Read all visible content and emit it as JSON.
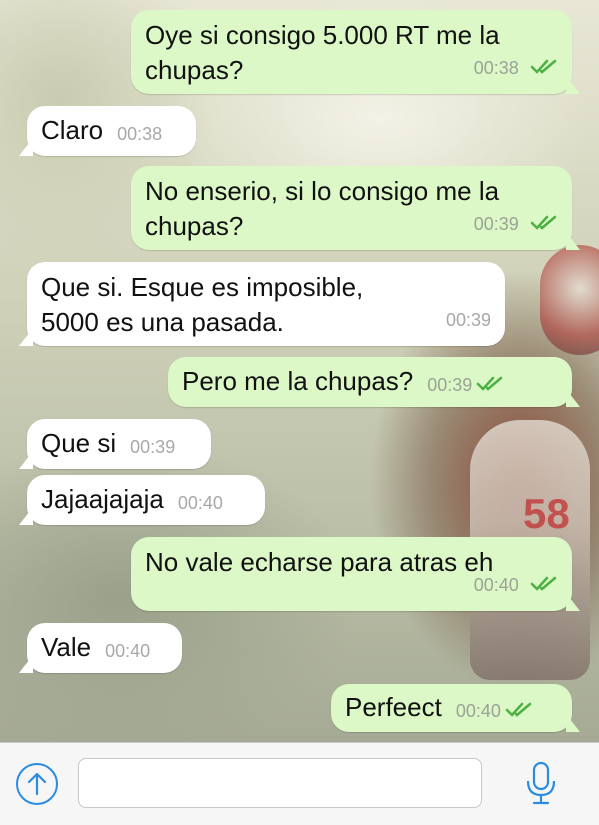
{
  "messages": [
    {
      "dir": "out",
      "text": "Oye si consigo 5.000 RT me la chupas?",
      "time": "00:38",
      "read": true
    },
    {
      "dir": "in",
      "text": "Claro",
      "time": "00:38"
    },
    {
      "dir": "out",
      "text": "No enserio, si lo consigo me la chupas?",
      "time": "00:39",
      "read": true
    },
    {
      "dir": "in",
      "text": "Que si. Esque es imposible, 5000 es una pasada.",
      "time": "00:39"
    },
    {
      "dir": "out",
      "text": "Pero me la chupas?",
      "time": "00:39",
      "read": true
    },
    {
      "dir": "in",
      "text": "Que si",
      "time": "00:39"
    },
    {
      "dir": "in",
      "text": "Jajaajajaja",
      "time": "00:40"
    },
    {
      "dir": "out",
      "text": "No vale echarse para atras eh",
      "time": "00:40",
      "read": true
    },
    {
      "dir": "in",
      "text": "Vale",
      "time": "00:40"
    },
    {
      "dir": "out",
      "text": "Perfeect",
      "time": "00:40",
      "read": true
    }
  ],
  "background_number": "58",
  "colors": {
    "outgoing_bubble": "#dcf8c6",
    "incoming_bubble": "#ffffff",
    "read_check": "#4cb043",
    "accent_blue": "#2c8ce0"
  },
  "input_bar": {
    "placeholder": "",
    "value": "",
    "attach_icon": "arrow-up-circle-icon",
    "mic_icon": "microphone-icon"
  }
}
